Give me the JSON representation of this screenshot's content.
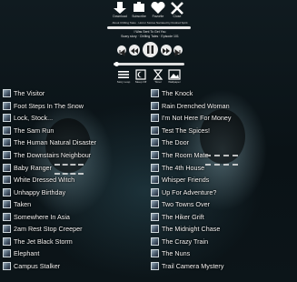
{
  "toolbar": {
    "items": [
      {
        "label": "Download",
        "icon": "download-arrow-icon"
      },
      {
        "label": "Subscribe",
        "icon": "subscribe-icon"
      },
      {
        "label": "Favorite",
        "icon": "heart-icon"
      },
      {
        "label": "Close",
        "icon": "close-x-icon"
      }
    ]
  },
  "header": {
    "tagline": "About Chilling Tales · Horror Stories Narrated by Kindred Spirit",
    "now_playing": "I Was Sent To Get You",
    "subtitle": "Scary story · Chilling Tales · Episode 101"
  },
  "player": {
    "buttons": [
      "previous",
      "rewind",
      "pause",
      "forward",
      "next"
    ],
    "progress": 0.02
  },
  "tools": [
    {
      "label": "Story Loop",
      "icon": "list-icon"
    },
    {
      "label": "Sleep Off",
      "icon": "moon-icon"
    },
    {
      "label": "Timer",
      "icon": "hourglass-icon"
    },
    {
      "label": "Wallpaper",
      "icon": "image-icon"
    }
  ],
  "stories_left": [
    "The Visitor",
    "Foot Steps In The Snow",
    "Lock, Stock...",
    "The Sam Run",
    "The Human Natural Disaster",
    "The Downstairs Neighbour",
    "Baby Ranger",
    "White Dressed Witch",
    "Unhappy Birthday",
    "Taken",
    "Somewhere In Asia",
    "2am Rest Stop Creeper",
    "The Jet Black Storm",
    "Elephant",
    "Campus Stalker"
  ],
  "stories_right": [
    "The Knock",
    "Rain Drenched Woman",
    "I'm Not Here For Money",
    "Test The Spices!",
    "The Door",
    "The Room Mate",
    "The 4th House",
    "Whisper Friends",
    "Up For Adventure?",
    "Two Towns Over",
    "The Hiker Grift",
    "The Midnight Chase",
    "The Crazy Train",
    "The Nuns",
    "Trail Camera Mystery"
  ]
}
